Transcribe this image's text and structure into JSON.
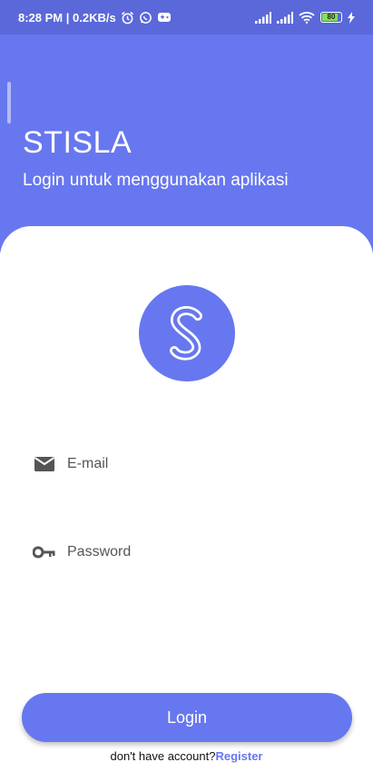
{
  "status_bar": {
    "time_speed": "8:28 PM | 0.2KB/s",
    "battery_level": "80",
    "icons": [
      "alarm-icon",
      "whatsapp-icon",
      "game-icon",
      "signal-icon",
      "signal-icon",
      "wifi-icon",
      "battery-icon",
      "charging-icon"
    ]
  },
  "header": {
    "title": "STISLA",
    "subtitle": "Login untuk menggunakan aplikasi"
  },
  "form": {
    "email_placeholder": "E-mail",
    "password_placeholder": "Password",
    "login_label": "Login",
    "register_prompt": "don't have account?",
    "register_link": "Register"
  },
  "colors": {
    "primary": "#6777ef",
    "status_bar": "#5a68d9",
    "battery_fill": "#7fe35a"
  }
}
